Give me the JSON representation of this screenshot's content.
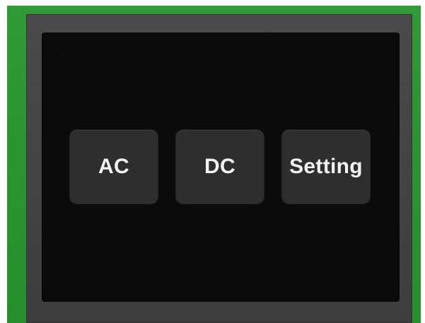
{
  "colors": {
    "board": "#2a9432",
    "bezel": "#444444",
    "screen": "#0b0b0b",
    "button_bg": "#2e2e2e",
    "button_text": "#f2f2f2"
  },
  "screen": {
    "buttons": [
      {
        "label": "AC"
      },
      {
        "label": "DC"
      },
      {
        "label": "Setting"
      }
    ]
  }
}
